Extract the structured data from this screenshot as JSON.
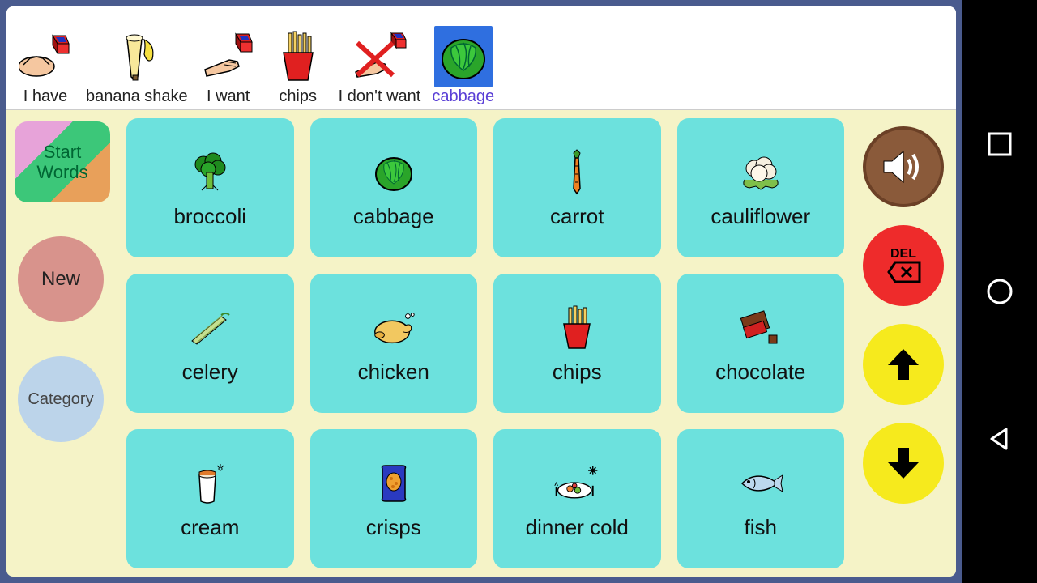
{
  "sentence": [
    {
      "label": "I have",
      "icon": "hand-cube",
      "selected": false
    },
    {
      "label": "banana shake",
      "icon": "banana-shake",
      "selected": false
    },
    {
      "label": "I want",
      "icon": "hand-want-cube",
      "selected": false
    },
    {
      "label": "chips",
      "icon": "chips",
      "selected": false
    },
    {
      "label": "I don't want",
      "icon": "hand-x-cube",
      "selected": false
    },
    {
      "label": "cabbage",
      "icon": "cabbage",
      "selected": true
    }
  ],
  "left": {
    "start_words": "Start\nWords",
    "new": "New",
    "category": "Category"
  },
  "grid": [
    {
      "label": "broccoli",
      "icon": "broccoli"
    },
    {
      "label": "cabbage",
      "icon": "cabbage"
    },
    {
      "label": "carrot",
      "icon": "carrot"
    },
    {
      "label": "cauliflower",
      "icon": "cauliflower"
    },
    {
      "label": "celery",
      "icon": "celery"
    },
    {
      "label": "chicken",
      "icon": "chicken"
    },
    {
      "label": "chips",
      "icon": "chips"
    },
    {
      "label": "chocolate",
      "icon": "chocolate"
    },
    {
      "label": "cream",
      "icon": "cream"
    },
    {
      "label": "crisps",
      "icon": "crisps"
    },
    {
      "label": "dinner cold",
      "icon": "dinner-cold"
    },
    {
      "label": "fish",
      "icon": "fish"
    }
  ],
  "right": {
    "speak": "speak",
    "del_label": "DEL",
    "up": "up",
    "down": "down"
  }
}
